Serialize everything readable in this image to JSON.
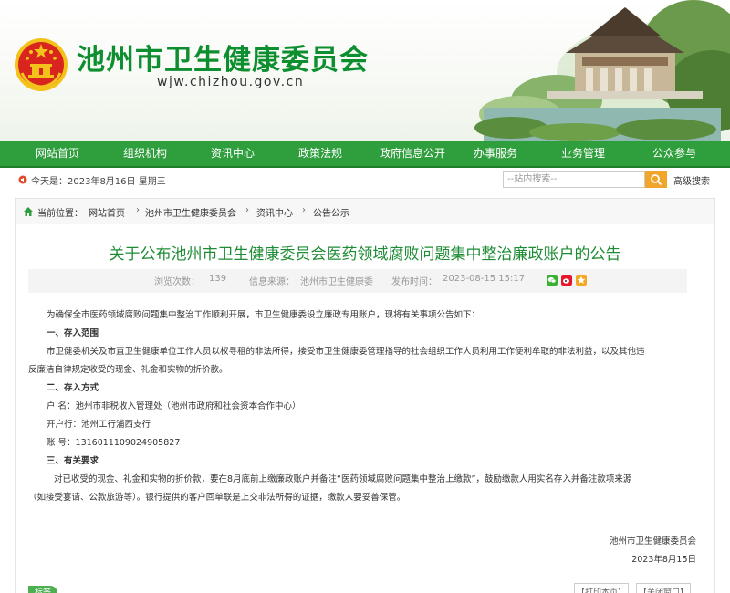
{
  "header": {
    "title": "池州市卫生健康委员会",
    "url": "wjw.chizhou.gov.cn"
  },
  "nav": {
    "items": [
      "网站首页",
      "组织机构",
      "资讯中心",
      "政策法规",
      "政府信息公开",
      "办事服务",
      "业务管理",
      "公众参与"
    ]
  },
  "info_bar": {
    "date": "今天是：2023年8月16日 星期三",
    "search_placeholder": "--站内搜索--",
    "advanced_search": "高级搜索"
  },
  "breadcrumb": {
    "label": "当前位置：",
    "items": [
      "网站首页",
      "池州市卫生健康委员会",
      "资讯中心",
      "公告公示"
    ],
    "separator": "›"
  },
  "article": {
    "title": "关于公布池州市卫生健康委员会医药领域腐败问题集中整治廉政账户的公告",
    "views_label": "浏览次数：",
    "views": "139",
    "source_label": "信息来源：",
    "source": "池州市卫生健康委",
    "time_label": "发布时间：",
    "time": "2023-08-15 15:17",
    "lines": [
      "为确保全市医药领域腐败问题集中整治工作顺利开展，市卫生健康委设立廉政专用账户，现将有关事项公告如下：",
      "一、存入范围",
      "市卫健委机关及市直卫生健康单位工作人员以权寻租的非法所得，接受市卫生健康委管理指导的社会组织工作人员利用工作便利牟取的非法利益，以及其他违",
      "反廉洁自律规定收受的现金、礼金和实物的折价款。",
      "二、存入方式",
      "户  名：池州市非税收入管理处（池州市政府和社会资本合作中心）",
      "开户行：池州工行浦西支行",
      "账  号：1316011109024905827",
      "三、有关要求",
      "对已收受的现金、礼金和实物的折价款，要在8月底前上缴廉政账户并备注“医药领域腐败问题集中整治上缴款”，鼓励缴款人用实名存入并备注款项来源",
      "（如接受宴请、公款旅游等）。银行提供的客户回单联是上交非法所得的证据，缴款人要妥善保管。"
    ],
    "signature": "池州市卫生健康委员会",
    "sign_date": "2023年8月15日"
  },
  "footer": {
    "print": "【打印本页】",
    "close": "【关闭窗口】",
    "tag": "标签"
  },
  "colors": {
    "brand_green": "#0d8f2f",
    "nav_green": "#2f9e3d",
    "title_green": "#1e8c34",
    "search_orange": "#f1a52a",
    "emblem_red": "#d8261f",
    "emblem_gold": "#f3c21b"
  }
}
